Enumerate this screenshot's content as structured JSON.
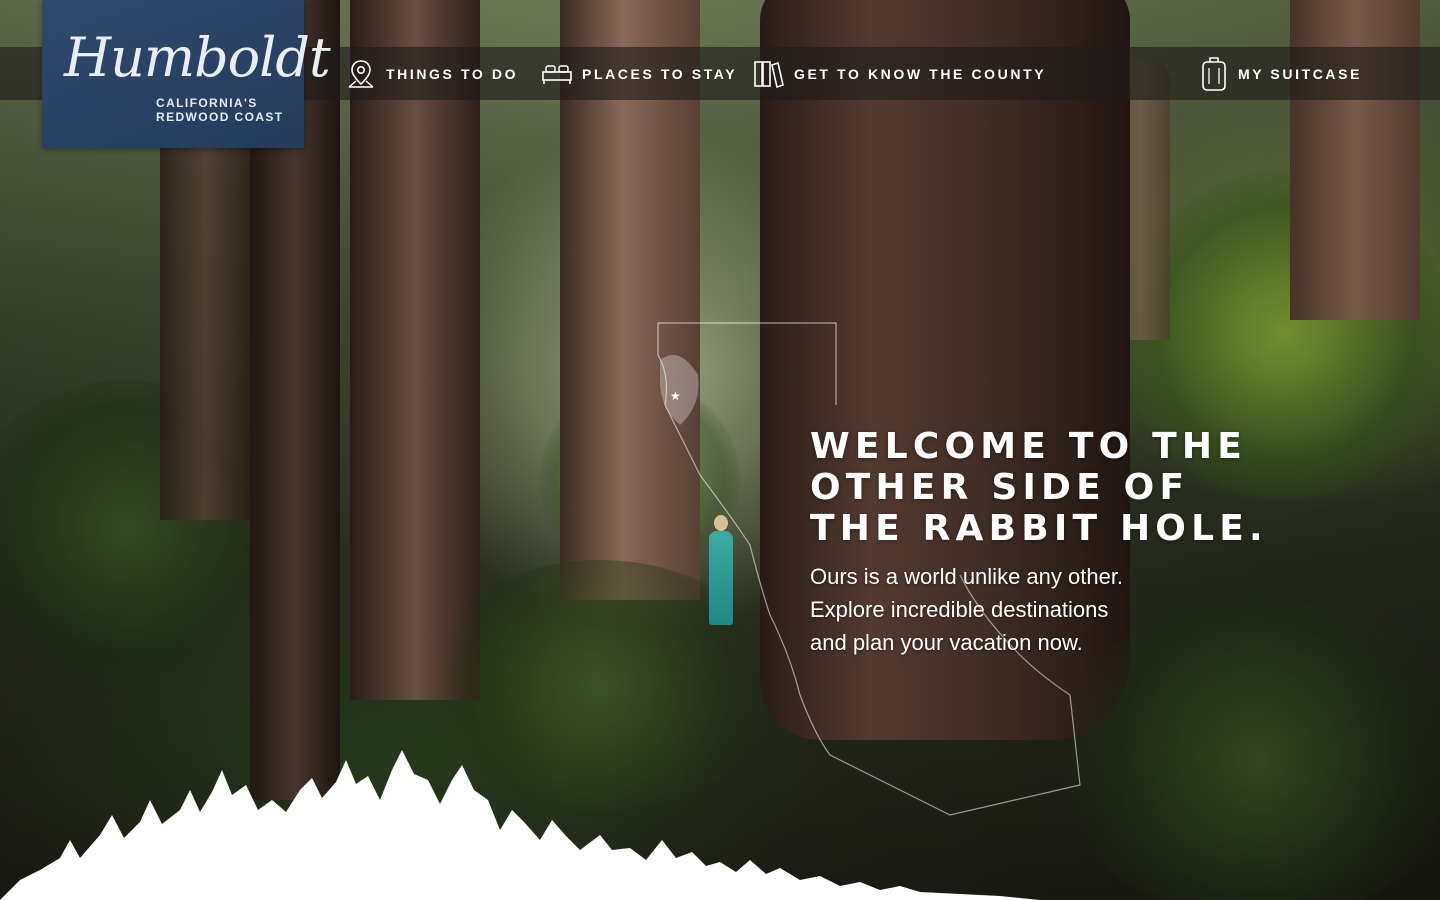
{
  "logo": {
    "script": "Humboldt",
    "line1": "CALIFORNIA'S",
    "line2": "REDWOOD COAST"
  },
  "nav": {
    "things_to_do": {
      "label": "THINGS TO DO",
      "icon": "map-pin-icon"
    },
    "places_to_stay": {
      "label": "PLACES TO STAY",
      "icon": "bed-icon"
    },
    "get_to_know": {
      "label": "GET TO KNOW THE COUNTY",
      "icon": "books-icon"
    },
    "suitcase": {
      "label": "MY SUITCASE",
      "icon": "suitcase-icon"
    }
  },
  "hero": {
    "headline": [
      "WELCOME TO THE",
      "OTHER SIDE OF",
      "THE RABBIT HOLE."
    ],
    "subtext": [
      "Ours is a world unlike any other.",
      "Explore incredible destinations",
      "and plan your vacation now."
    ]
  },
  "colors": {
    "logo_bg": "#2a4263",
    "nav_bg": "rgba(30,28,26,0.62)",
    "text": "#ffffff"
  }
}
